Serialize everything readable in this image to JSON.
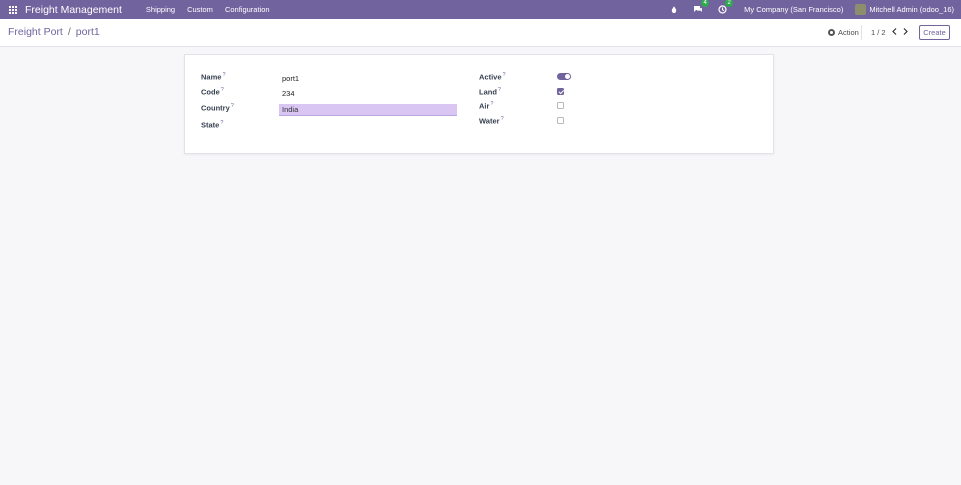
{
  "navbar": {
    "app_title": "Freight Management",
    "menu": [
      "Shipping",
      "Custom",
      "Configuration"
    ],
    "messages_count": "4",
    "activities_count": "2",
    "company": "My Company (San Francisco)",
    "user": "Mitchell Admin (odoo_16)",
    "accent_color": "#71639e"
  },
  "breadcrumb": {
    "parent": "Freight Port",
    "separator": "/",
    "current": "port1"
  },
  "control": {
    "action_label": "Action",
    "pager": "1 / 2",
    "create_label": "Create"
  },
  "form": {
    "left": {
      "name_label": "Name",
      "name_value": "port1",
      "code_label": "Code",
      "code_value": "234",
      "country_label": "Country",
      "country_value": "India",
      "state_label": "State",
      "state_value": ""
    },
    "right": {
      "active_label": "Active",
      "active_value": true,
      "land_label": "Land",
      "land_value": true,
      "air_label": "Air",
      "air_value": false,
      "water_label": "Water",
      "water_value": false
    },
    "help_marker": "?"
  }
}
